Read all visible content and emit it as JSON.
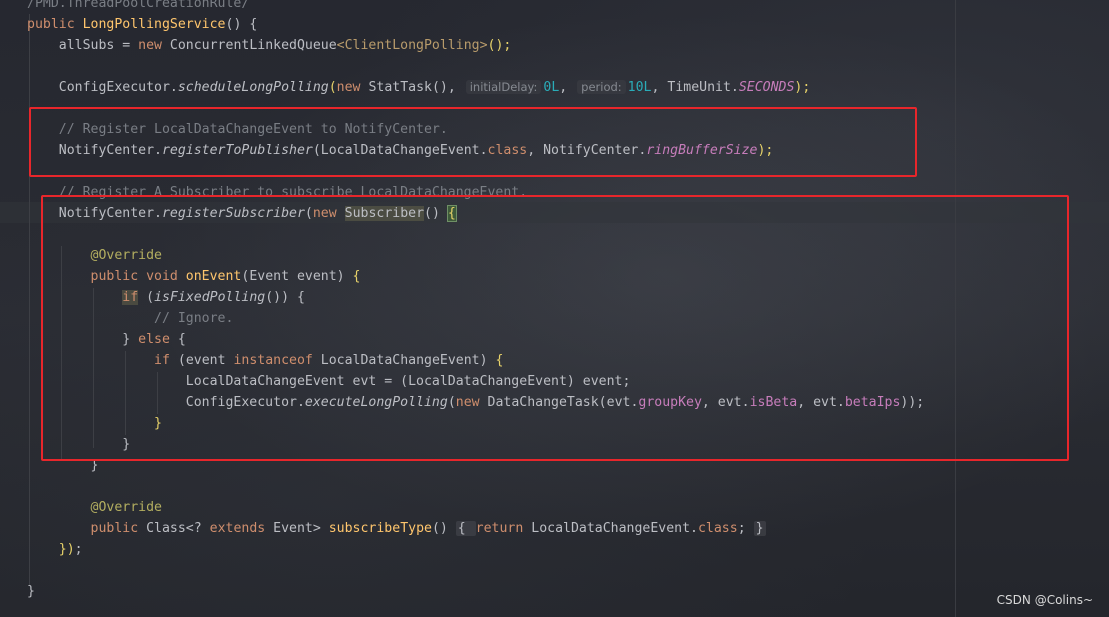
{
  "editor": {
    "lines": [
      [
        {
          "t": "/PMD.ThreadPoolCreationRule/",
          "c": "cm"
        }
      ],
      [
        {
          "t": "public ",
          "c": "kw"
        },
        {
          "t": "LongPollingService",
          "c": "mdecl"
        },
        {
          "t": "() {",
          "c": ""
        }
      ],
      [
        {
          "t": "    allSubs = ",
          "c": ""
        },
        {
          "t": "new ",
          "c": "kw"
        },
        {
          "t": "ConcurrentLinkedQueue",
          "c": "ty"
        },
        {
          "t": "<ClientLongPolling>",
          "c": "gen"
        },
        {
          "t": "();",
          "c": "brace-y"
        }
      ],
      [],
      [
        {
          "t": "    ConfigExecutor.",
          "c": ""
        },
        {
          "t": "scheduleLongPolling",
          "c": "it-fn"
        },
        {
          "t": "(",
          "c": "brace-y"
        },
        {
          "t": "new ",
          "c": "kw"
        },
        {
          "t": "StatTask(), ",
          "c": ""
        },
        {
          "t": "initialDelay:",
          "c": "hint"
        },
        {
          "t": "0L",
          "c": "num"
        },
        {
          "t": ", ",
          "c": ""
        },
        {
          "t": "period:",
          "c": "hint"
        },
        {
          "t": "10L",
          "c": "num"
        },
        {
          "t": ", TimeUnit.",
          "c": ""
        },
        {
          "t": "SECONDS",
          "c": "field-it"
        },
        {
          "t": ");",
          "c": "brace-y"
        }
      ],
      [],
      [
        {
          "t": "    // Register LocalDataChangeEvent to NotifyCenter.",
          "c": "cm"
        }
      ],
      [
        {
          "t": "    NotifyCenter.",
          "c": ""
        },
        {
          "t": "registerToPublisher",
          "c": "it-fn"
        },
        {
          "t": "(LocalDataChangeEvent.",
          "c": ""
        },
        {
          "t": "class",
          "c": "kw"
        },
        {
          "t": ", NotifyCenter.",
          "c": ""
        },
        {
          "t": "ringBufferSize",
          "c": "field-it"
        },
        {
          "t": ");",
          "c": "brace-y"
        }
      ],
      [],
      [
        {
          "t": "    // Register A Subscriber to subscribe LocalDataChangeEvent.",
          "c": "cm"
        }
      ],
      [
        {
          "t": "    NotifyCenter.",
          "c": ""
        },
        {
          "t": "registerSubscriber",
          "c": "it-fn"
        },
        {
          "t": "(",
          "c": ""
        },
        {
          "t": "new ",
          "c": "kw"
        },
        {
          "t": "Subscriber",
          "c": "hl-type"
        },
        {
          "t": "() ",
          "c": ""
        },
        {
          "t": "{",
          "c": "hl-brace"
        }
      ],
      [],
      [
        {
          "t": "        @Override",
          "c": "ann"
        }
      ],
      [
        {
          "t": "        public void ",
          "c": "kw"
        },
        {
          "t": "onEvent",
          "c": "mdecl"
        },
        {
          "t": "(Event event) ",
          "c": ""
        },
        {
          "t": "{",
          "c": "brace-y"
        }
      ],
      [
        {
          "t": "            ",
          "c": ""
        },
        {
          "t": "if",
          "c": "kw hl-type"
        },
        {
          "t": " (",
          "c": ""
        },
        {
          "t": "isFixedPolling",
          "c": "it-fn"
        },
        {
          "t": "()) {",
          "c": ""
        }
      ],
      [
        {
          "t": "                // Ignore.",
          "c": "cm"
        }
      ],
      [
        {
          "t": "            } ",
          "c": ""
        },
        {
          "t": "else ",
          "c": "kw"
        },
        {
          "t": "{",
          "c": ""
        }
      ],
      [
        {
          "t": "                ",
          "c": ""
        },
        {
          "t": "if ",
          "c": "kw"
        },
        {
          "t": "(event ",
          "c": ""
        },
        {
          "t": "instanceof ",
          "c": "kw"
        },
        {
          "t": "LocalDataChangeEvent) ",
          "c": ""
        },
        {
          "t": "{",
          "c": "brace-y"
        }
      ],
      [
        {
          "t": "                    LocalDataChangeEvent evt = (LocalDataChangeEvent) event;",
          "c": ""
        }
      ],
      [
        {
          "t": "                    ConfigExecutor.",
          "c": ""
        },
        {
          "t": "executeLongPolling",
          "c": "it-fn"
        },
        {
          "t": "(",
          "c": ""
        },
        {
          "t": "new ",
          "c": "kw"
        },
        {
          "t": "DataChangeTask(evt.",
          "c": ""
        },
        {
          "t": "groupKey",
          "c": "field"
        },
        {
          "t": ", evt.",
          "c": ""
        },
        {
          "t": "isBeta",
          "c": "field"
        },
        {
          "t": ", evt.",
          "c": ""
        },
        {
          "t": "betaIps",
          "c": "field"
        },
        {
          "t": "));",
          "c": ""
        }
      ],
      [
        {
          "t": "                ",
          "c": ""
        },
        {
          "t": "}",
          "c": "brace-y"
        }
      ],
      [
        {
          "t": "            }",
          "c": ""
        }
      ],
      [
        {
          "t": "        }",
          "c": ""
        }
      ],
      [],
      [
        {
          "t": "        @Override",
          "c": "ann"
        }
      ],
      [
        {
          "t": "        public ",
          "c": "kw"
        },
        {
          "t": "Class<? ",
          "c": ""
        },
        {
          "t": "extends ",
          "c": "kw"
        },
        {
          "t": "Event> ",
          "c": ""
        },
        {
          "t": "subscribeType",
          "c": "mdecl"
        },
        {
          "t": "() ",
          "c": ""
        },
        {
          "t": "{ ",
          "c": "fold"
        },
        {
          "t": "return ",
          "c": "kw"
        },
        {
          "t": "LocalDataChangeEvent.",
          "c": ""
        },
        {
          "t": "class",
          "c": "kw"
        },
        {
          "t": "; ",
          "c": ""
        },
        {
          "t": "}",
          "c": "fold"
        }
      ],
      [
        {
          "t": "    ",
          "c": ""
        },
        {
          "t": "})",
          "c": "brace-y"
        },
        {
          "t": ";",
          "c": ""
        }
      ],
      [],
      [
        {
          "t": "}",
          "c": ""
        }
      ]
    ]
  },
  "watermark": "CSDN @Colins~",
  "colors": {
    "annotation_box": "#e8262b",
    "background": "#23252b"
  }
}
